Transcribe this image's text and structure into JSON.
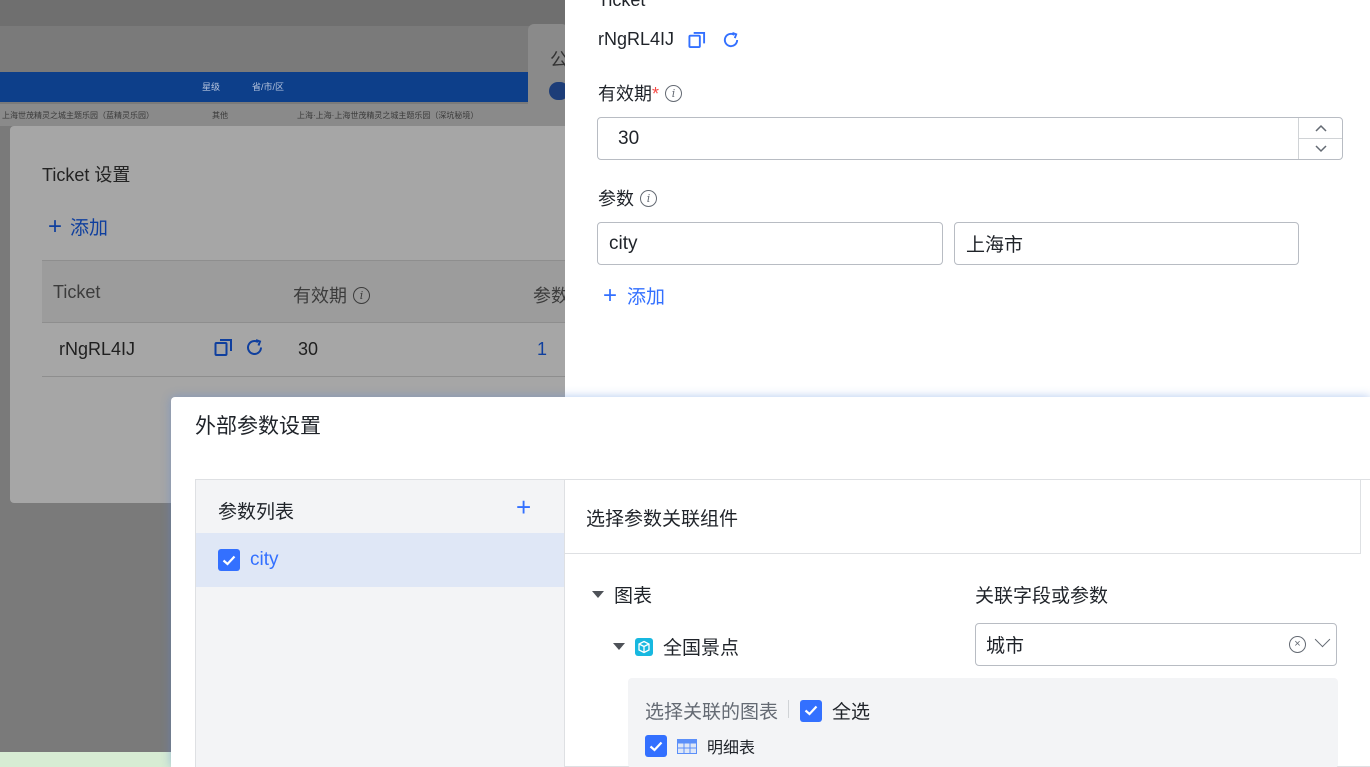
{
  "background": {
    "table_headers": [
      "星级",
      "省/市/区"
    ],
    "table_row": [
      "上海世茂精灵之城主题乐园（蓝精灵乐园）",
      "其他",
      "上海·上海·上海世茂精灵之城主题乐园（深坑秘境）"
    ],
    "right_card_char": "公"
  },
  "ticket_modal": {
    "title": "Ticket 设置",
    "add_label": "添加",
    "columns": [
      "Ticket",
      "有效期",
      "参数"
    ],
    "rows": [
      {
        "ticket": "rNgRL4IJ",
        "validity": "30",
        "params": "1"
      }
    ]
  },
  "ticket_drawer": {
    "ticket_label": "Ticket",
    "ticket_value": "rNgRL4IJ",
    "validity_label": "有效期",
    "validity_required": "*",
    "validity_value": "30",
    "params_label": "参数",
    "param_key": "city",
    "param_value": "上海市",
    "add_label": "添加"
  },
  "ext_params_modal": {
    "title": "外部参数设置",
    "param_list_title": "参数列表",
    "params": [
      {
        "name": "city",
        "checked": true
      }
    ],
    "component_title": "选择参数关联组件",
    "tree": {
      "group_label": "图表",
      "chart_label": "全国景点"
    },
    "assoc_label": "关联字段或参数",
    "assoc_value": "城市",
    "chart_select_label": "选择关联的图表",
    "select_all_label": "全选",
    "detail_label": "明细表"
  },
  "colors": {
    "accent": "#3370ff",
    "required": "#f54a45",
    "dim_blue": "#0d3f8a"
  }
}
